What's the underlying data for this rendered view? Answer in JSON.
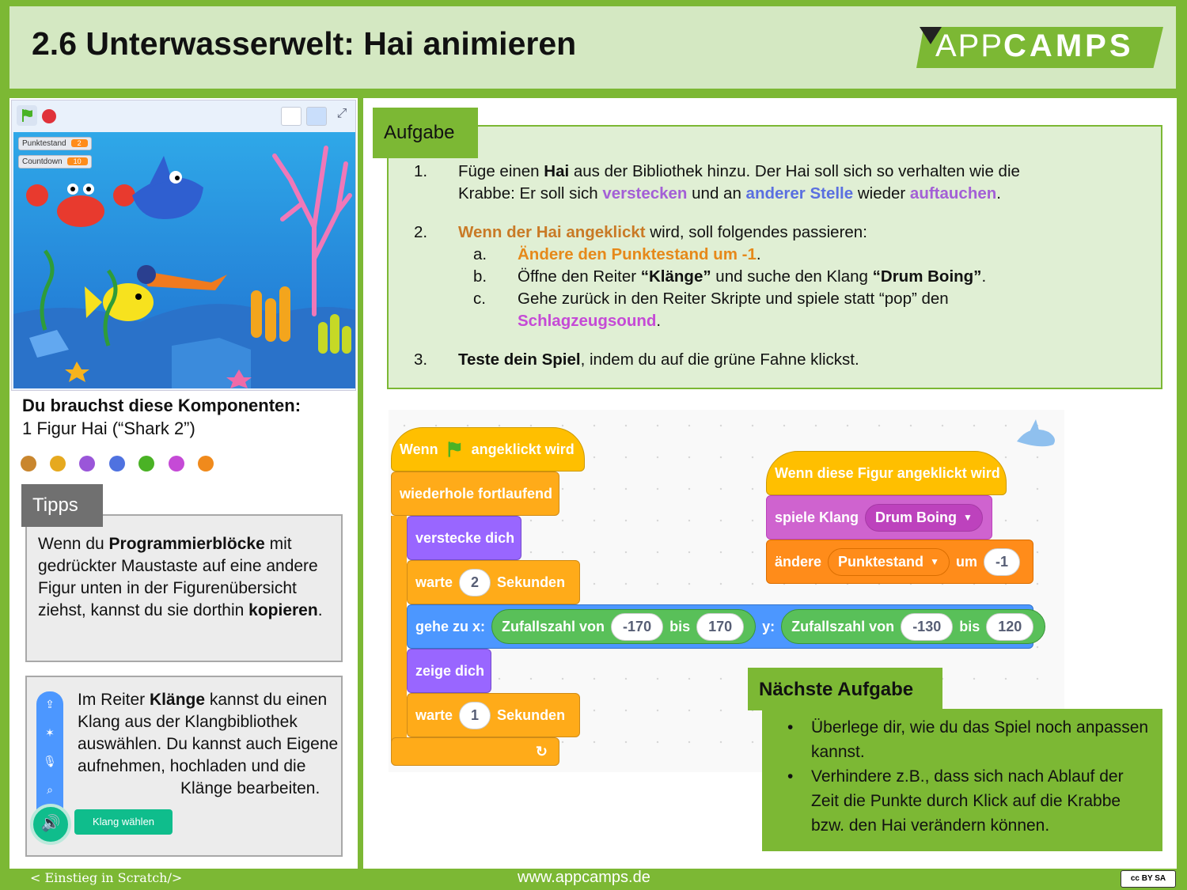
{
  "header": {
    "title": "2.6 Unterwasserwelt: Hai animieren",
    "logo_light": "APP",
    "logo_bold": "CAMPS"
  },
  "stage": {
    "monitors": [
      {
        "label": "Punktestand",
        "value": "2"
      },
      {
        "label": "Countdown",
        "value": "10"
      }
    ]
  },
  "components": {
    "title": "Du brauchst diese Komponenten:",
    "item": "1 Figur Hai (“Shark 2”)",
    "dot_colors": [
      "#c9862e",
      "#e6a91f",
      "#9a56d9",
      "#4f72e0",
      "#4ab225",
      "#c54ad6",
      "#f08a1c"
    ]
  },
  "tipps": {
    "tab": "Tipps",
    "text_parts": [
      "Wenn du ",
      "Programmierblöcke",
      " mit gedrückter Maustaste auf eine andere Figur unten in der Figurenübersicht ziehst, kannst du sie dorthin ",
      "kopieren",
      "."
    ]
  },
  "klang_tip": {
    "parts": [
      "Im Reiter ",
      "Klänge",
      " kannst du einen Klang aus der Klangbibliothek auswählen. Du kannst auch Eigene aufnehmen, hochladen und die"
    ],
    "last_line": "Klänge bearbeiten.",
    "button": "Klang wählen"
  },
  "aufgabe": {
    "tab": "Aufgabe",
    "n1": "1.",
    "t1": [
      "Füge einen ",
      "Hai",
      " aus der Bibliothek hinzu. Der Hai soll sich so verhalten wie die"
    ],
    "t1b": [
      "Krabbe: Er soll sich ",
      "verstecken",
      " und an ",
      "anderer Stelle",
      " wieder ",
      "auftauchen",
      "."
    ],
    "n2": "2.",
    "t2": [
      "Wenn der Hai angeklickt",
      " wird, soll folgendes passieren:"
    ],
    "a": "a.",
    "ta": [
      "Ändere den Punktestand um -1",
      "."
    ],
    "b": "b.",
    "tb": [
      "Öffne den Reiter ",
      "“Klänge”",
      " und suche den Klang ",
      "“Drum Boing”",
      "."
    ],
    "c": "c.",
    "tc": "Gehe zurück in den Reiter Skripte und spiele statt “pop” den",
    "tc2": [
      "Schlagzeugsound",
      "."
    ],
    "n3": "3.",
    "t3": [
      "Teste dein Spiel",
      ", indem du auf die grüne Fahne klickst."
    ]
  },
  "code": {
    "hat1_a": "Wenn",
    "hat1_b": "angeklickt wird",
    "forever": "wiederhole fortlaufend",
    "hide": "verstecke dich",
    "wait": "warte",
    "wait1_val": "2",
    "seconds": "Sekunden",
    "goto": "gehe zu x:",
    "random": "Zufallszahl von",
    "bis": "bis",
    "x_from": "-170",
    "x_to": "170",
    "y_label": "y:",
    "y_from": "-130",
    "y_to": "120",
    "show": "zeige dich",
    "wait2_val": "1",
    "hat2": "Wenn diese Figur angeklickt wird",
    "play_sound": "spiele Klang",
    "sound_name": "Drum Boing",
    "change": "ändere",
    "var_name": "Punktestand",
    "um": "um",
    "change_val": "-1"
  },
  "next": {
    "tab": "Nächste Aufgabe",
    "bullets": [
      "Überlege dir, wie du das Spiel noch anpassen kannst.",
      "Verhindere z.B., dass sich nach Ablauf der Zeit die Punkte durch Klick auf die Krabbe bzw. den Hai verändern können."
    ]
  },
  "footer": {
    "left": "< Einstieg in Scratch/>",
    "url": "www.appcamps.de",
    "license": "cc BY SA"
  }
}
